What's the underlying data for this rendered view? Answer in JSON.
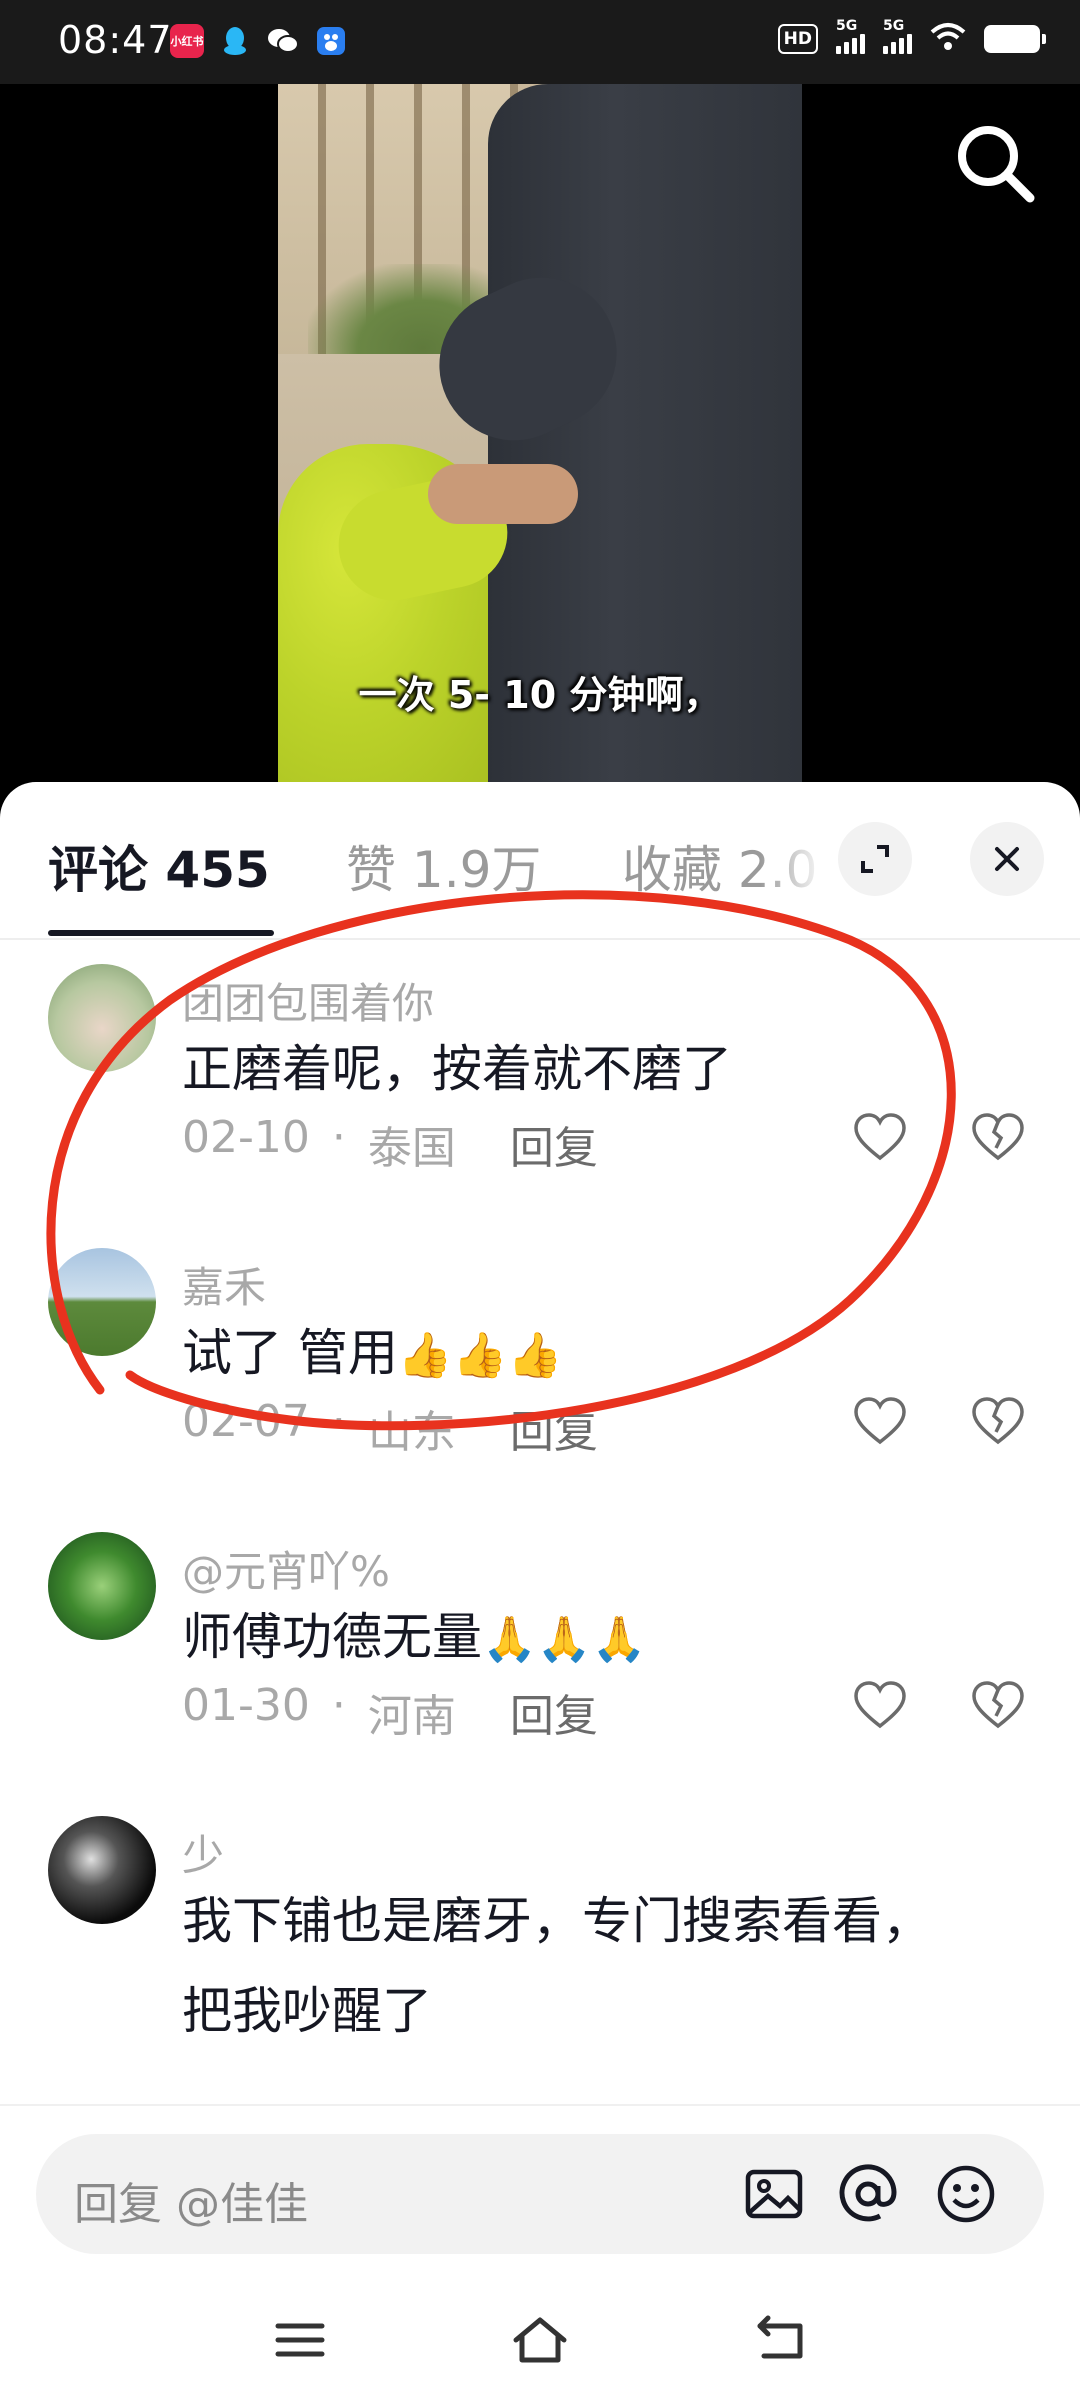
{
  "status_bar": {
    "time": "08:47",
    "icons": [
      "xiaohongshu-icon",
      "qq-icon",
      "wechat-icon",
      "baidu-icon"
    ],
    "hd_label": "HD",
    "signal_1": "5G",
    "signal_2": "5G"
  },
  "video": {
    "subtitle": "一次 5- 10 分钟啊，"
  },
  "tabs": {
    "comments": "评论 455",
    "likes": "赞 1.9万",
    "favorites": "收藏 2.0"
  },
  "comments": [
    {
      "user": "团团包围着你",
      "text": "正磨着呢，按着就不磨了",
      "emoji": "",
      "date": "02-10",
      "location": "泰国",
      "reply": "回复"
    },
    {
      "user": "嘉禾",
      "text": "试了 管用",
      "emoji": "👍👍👍",
      "date": "02-07",
      "location": "山东",
      "reply": "回复"
    },
    {
      "user": "@元宵吖%",
      "text": "师傅功德无量",
      "emoji": "🙏🙏🙏",
      "date": "01-30",
      "location": "河南",
      "reply": "回复"
    },
    {
      "user": "少",
      "text": "我下铺也是磨牙，专门搜索看看，把我吵醒了",
      "emoji": "",
      "date": "",
      "location": "",
      "reply": ""
    }
  ],
  "input": {
    "placeholder": "回复 @佳佳"
  },
  "colors": {
    "annotation": "#e8321e",
    "text_primary": "#161823",
    "text_secondary": "#a8a8a8"
  }
}
